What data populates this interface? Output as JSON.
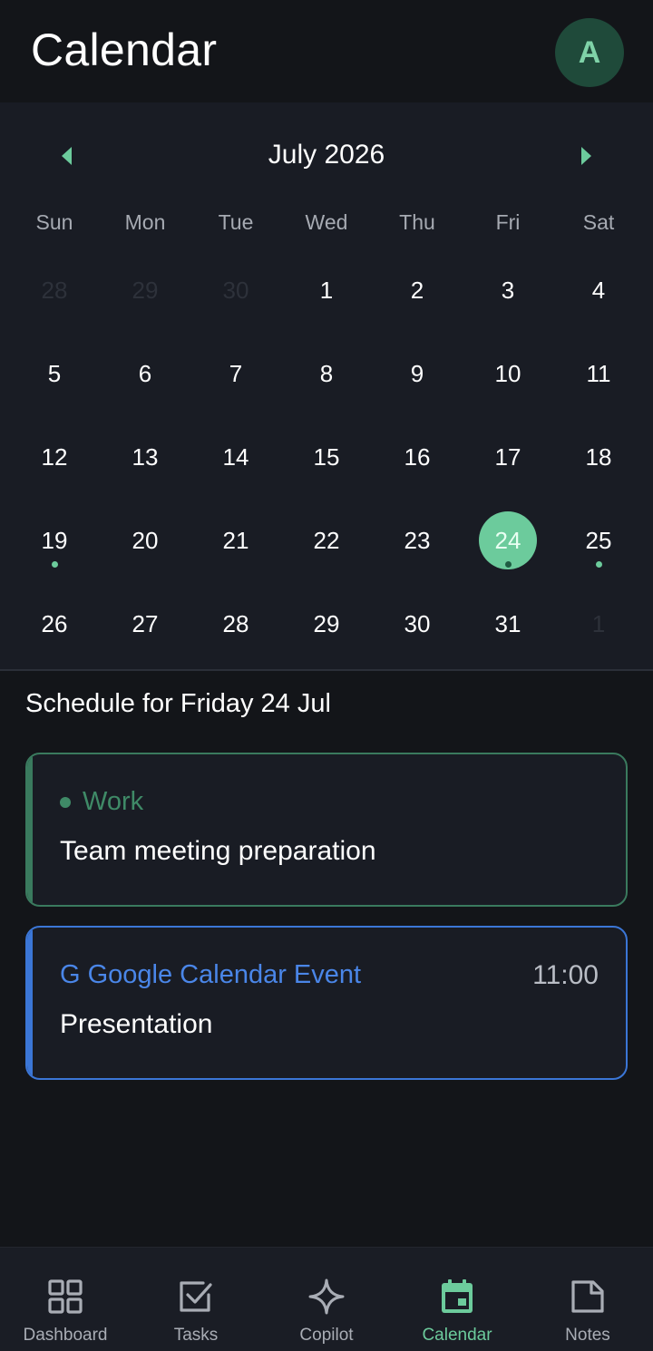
{
  "header": {
    "title": "Calendar",
    "avatar_initial": "A"
  },
  "calendar": {
    "month_label": "July 2026",
    "weekdays": [
      "Sun",
      "Mon",
      "Tue",
      "Wed",
      "Thu",
      "Fri",
      "Sat"
    ],
    "weeks": [
      [
        {
          "d": "28",
          "muted": true
        },
        {
          "d": "29",
          "muted": true
        },
        {
          "d": "30",
          "muted": true
        },
        {
          "d": "1"
        },
        {
          "d": "2"
        },
        {
          "d": "3"
        },
        {
          "d": "4"
        }
      ],
      [
        {
          "d": "5"
        },
        {
          "d": "6"
        },
        {
          "d": "7"
        },
        {
          "d": "8"
        },
        {
          "d": "9"
        },
        {
          "d": "10"
        },
        {
          "d": "11"
        }
      ],
      [
        {
          "d": "12"
        },
        {
          "d": "13"
        },
        {
          "d": "14"
        },
        {
          "d": "15"
        },
        {
          "d": "16"
        },
        {
          "d": "17"
        },
        {
          "d": "18"
        }
      ],
      [
        {
          "d": "19",
          "dot": true
        },
        {
          "d": "20"
        },
        {
          "d": "21"
        },
        {
          "d": "22"
        },
        {
          "d": "23"
        },
        {
          "d": "24",
          "dot": true,
          "selected": true
        },
        {
          "d": "25",
          "dot": true
        }
      ],
      [
        {
          "d": "26"
        },
        {
          "d": "27"
        },
        {
          "d": "28"
        },
        {
          "d": "29"
        },
        {
          "d": "30"
        },
        {
          "d": "31"
        },
        {
          "d": "1",
          "muted": true
        }
      ]
    ]
  },
  "schedule": {
    "title": "Schedule for Friday 24 Jul",
    "events": [
      {
        "tag": "Work",
        "title": "Team meeting preparation",
        "color": "#3f8a67"
      },
      {
        "tag": "G Google Calendar Event",
        "title": "Presentation",
        "time": "11:00",
        "color": "#4a86e8"
      }
    ]
  },
  "bottom_nav": {
    "items": [
      {
        "label": "Dashboard",
        "icon": "dashboard-grid-icon",
        "active": false
      },
      {
        "label": "Tasks",
        "icon": "checkbox-icon",
        "active": false
      },
      {
        "label": "Copilot",
        "icon": "sparkle-icon",
        "active": false
      },
      {
        "label": "Calendar",
        "icon": "calendar-icon",
        "active": true
      },
      {
        "label": "Notes",
        "icon": "note-icon",
        "active": false
      }
    ]
  },
  "colors": {
    "accent": "#6ccb9c",
    "background": "#131519",
    "panel": "#191c24",
    "work": "#3f8a67",
    "google": "#4a86e8"
  }
}
